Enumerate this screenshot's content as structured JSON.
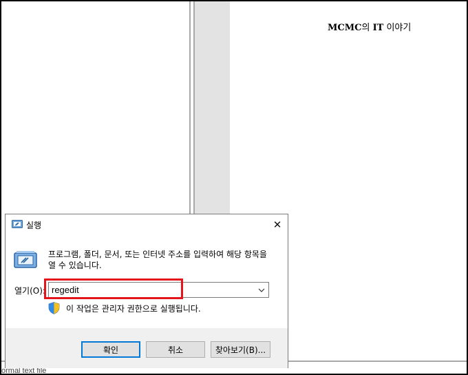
{
  "watermark": {
    "brand": "MCMC",
    "middle": "의 ",
    "it": "IT",
    "suffix": " 이야기"
  },
  "background": {
    "status_text": "ormal text file"
  },
  "dialog": {
    "title": "실행",
    "close_glyph": "✕",
    "description": "프로그램, 폴더, 문서, 또는 인터넷 주소를 입력하여 해당 항목을 열 수 있습니다.",
    "open_label": "열기(O):",
    "open_value": "regedit",
    "admin_note": "이 작업은 관리자 권한으로 실행됩니다.",
    "buttons": {
      "ok": "확인",
      "cancel": "취소",
      "browse": "찾아보기(B)..."
    }
  },
  "icons": [
    "run-app-icon",
    "shield-icon",
    "close-icon",
    "chevron-down-icon"
  ],
  "colors": {
    "highlight": "#e4141b",
    "default_button_border": "#0078d7",
    "button_bar": "#f0f0f0"
  }
}
